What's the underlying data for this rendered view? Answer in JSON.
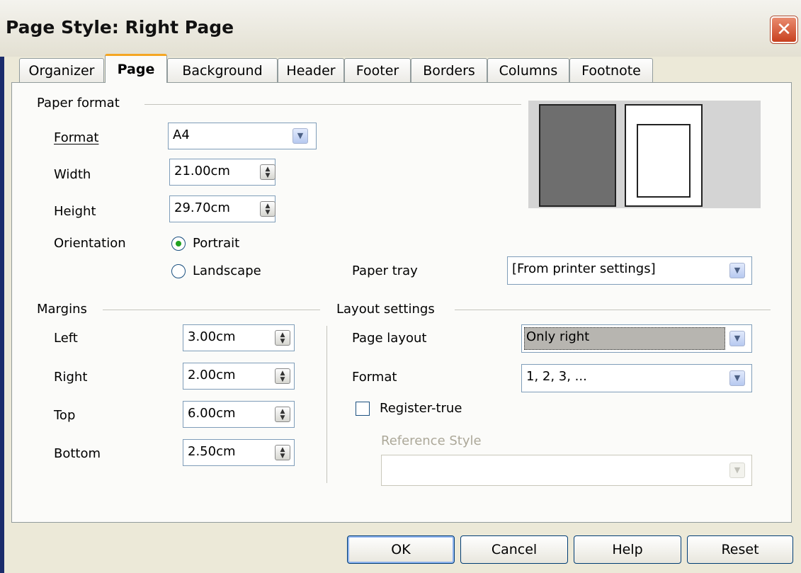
{
  "window": {
    "title": "Page Style: Right Page",
    "close_glyph": "✕"
  },
  "tabs": [
    {
      "label": "Organizer"
    },
    {
      "label": "Page",
      "active": true
    },
    {
      "label": "Background"
    },
    {
      "label": "Header"
    },
    {
      "label": "Footer"
    },
    {
      "label": "Borders"
    },
    {
      "label": "Columns"
    },
    {
      "label": "Footnote"
    }
  ],
  "paper_format": {
    "heading": "Paper format",
    "format_label": "Format",
    "format_value": "A4",
    "width_label": "Width",
    "width_value": "21.00cm",
    "height_label": "Height",
    "height_value": "29.70cm",
    "orientation_label": "Orientation",
    "portrait_label": "Portrait",
    "landscape_label": "Landscape",
    "orientation_selected": "Portrait",
    "paper_tray_label": "Paper tray",
    "paper_tray_value": "[From printer settings]"
  },
  "margins": {
    "heading": "Margins",
    "left_label": "Left",
    "left_value": "3.00cm",
    "right_label": "Right",
    "right_value": "2.00cm",
    "top_label": "Top",
    "top_value": "6.00cm",
    "bottom_label": "Bottom",
    "bottom_value": "2.50cm"
  },
  "layout_settings": {
    "heading": "Layout settings",
    "page_layout_label": "Page layout",
    "page_layout_value": "Only right",
    "format_label": "Format",
    "format_value": "1, 2, 3, ...",
    "register_true_label": "Register-true",
    "register_true_checked": false,
    "reference_style_label": "Reference Style",
    "reference_style_value": ""
  },
  "buttons": {
    "ok": "OK",
    "cancel": "Cancel",
    "help": "Help",
    "reset": "Reset"
  },
  "colors": {
    "dialog_bg": "#ece9d8",
    "tab_accent": "#f5a623",
    "close_red": "#c8401f",
    "radio_selected": "#21a121"
  }
}
